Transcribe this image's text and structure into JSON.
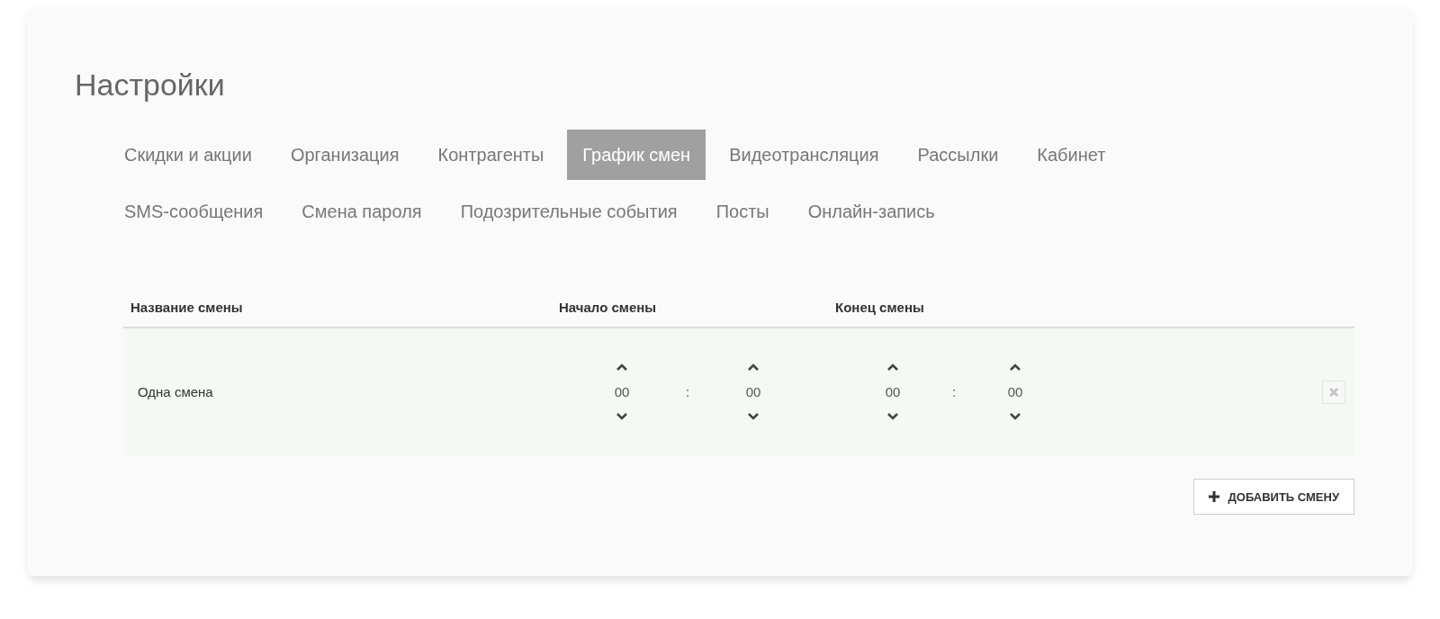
{
  "title": "Настройки",
  "tab_rows": [
    [
      {
        "label": "Скидки и акции",
        "selected": false
      },
      {
        "label": "Организация",
        "selected": false
      },
      {
        "label": "Контрагенты",
        "selected": false
      },
      {
        "label": "График смен",
        "selected": true
      },
      {
        "label": "Видеотрансляция",
        "selected": false
      },
      {
        "label": "Рассылки",
        "selected": false
      },
      {
        "label": "Кабинет",
        "selected": false
      }
    ],
    [
      {
        "label": "SMS-сообщения",
        "selected": false
      },
      {
        "label": "Смена пароля",
        "selected": false
      },
      {
        "label": "Подозрительные события",
        "selected": false
      },
      {
        "label": "Посты",
        "selected": false
      },
      {
        "label": "Онлайн-запись",
        "selected": false
      }
    ]
  ],
  "table": {
    "columns": [
      "Название смены",
      "Начало смены",
      "Конец смены"
    ],
    "rows": [
      {
        "name": "Одна смена",
        "start": {
          "hours": "00",
          "separator": ":",
          "minutes": "00"
        },
        "end": {
          "hours": "00",
          "separator": ":",
          "minutes": "00"
        }
      }
    ]
  },
  "add_button": "ДОБАВИТЬ СМЕНУ"
}
